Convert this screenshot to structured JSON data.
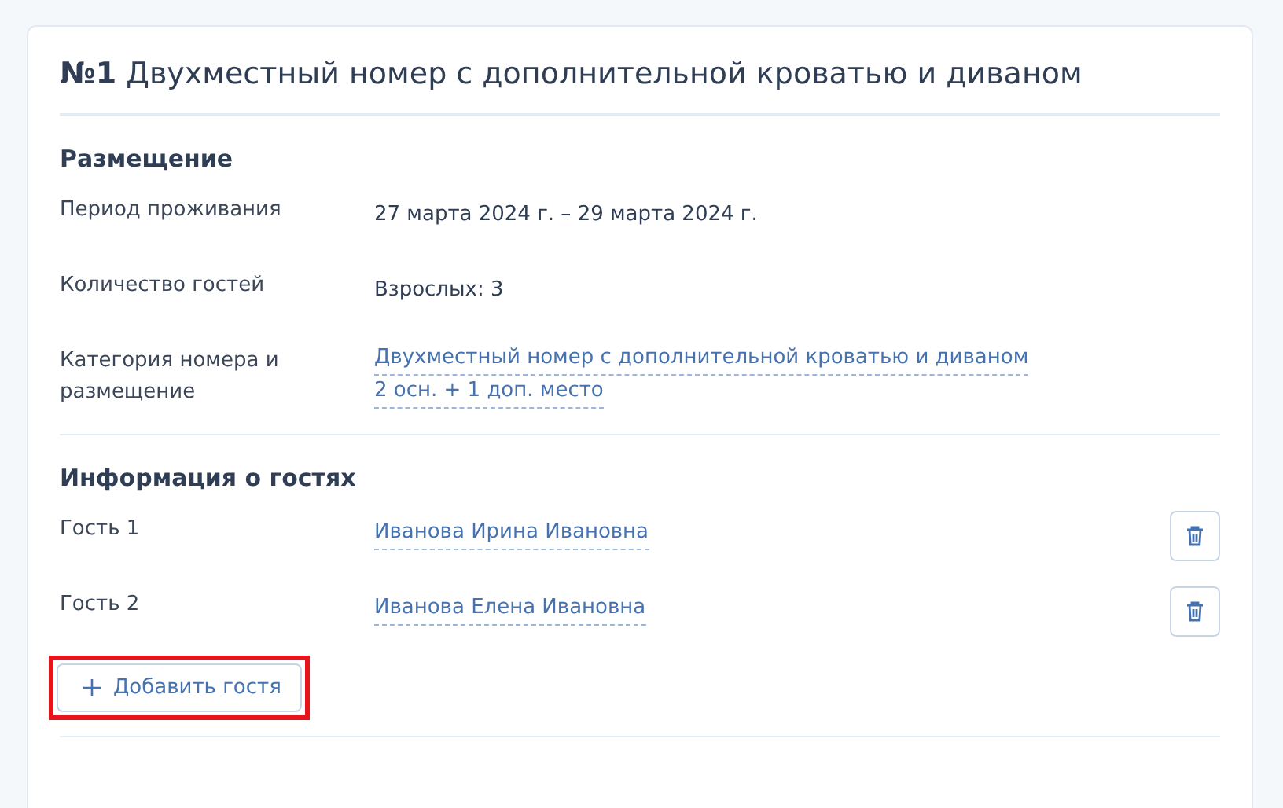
{
  "card": {
    "number": "№1",
    "title": "Двухместный номер с дополнительной кроватью и диваном"
  },
  "placement": {
    "heading": "Размещение",
    "rows": [
      {
        "kind": "text",
        "label": "Период проживания",
        "values": [
          "27 марта 2024 г. – 29 марта 2024 г."
        ]
      },
      {
        "kind": "text",
        "label": "Количество гостей",
        "values": [
          "Взрослых: 3"
        ]
      },
      {
        "kind": "link",
        "label": "Категория номера и размещение",
        "values": [
          "Двухместный номер с дополнительной кроватью и диваном",
          "2 осн. + 1 доп. место"
        ]
      }
    ]
  },
  "guests": {
    "heading": "Информация о гостях",
    "rows": [
      {
        "label": "Гость 1",
        "name": "Иванова Ирина Ивановна"
      },
      {
        "label": "Гость 2",
        "name": "Иванова Елена Ивановна"
      }
    ],
    "add_button": {
      "label": "Добавить гостя",
      "highlighted": true
    }
  }
}
